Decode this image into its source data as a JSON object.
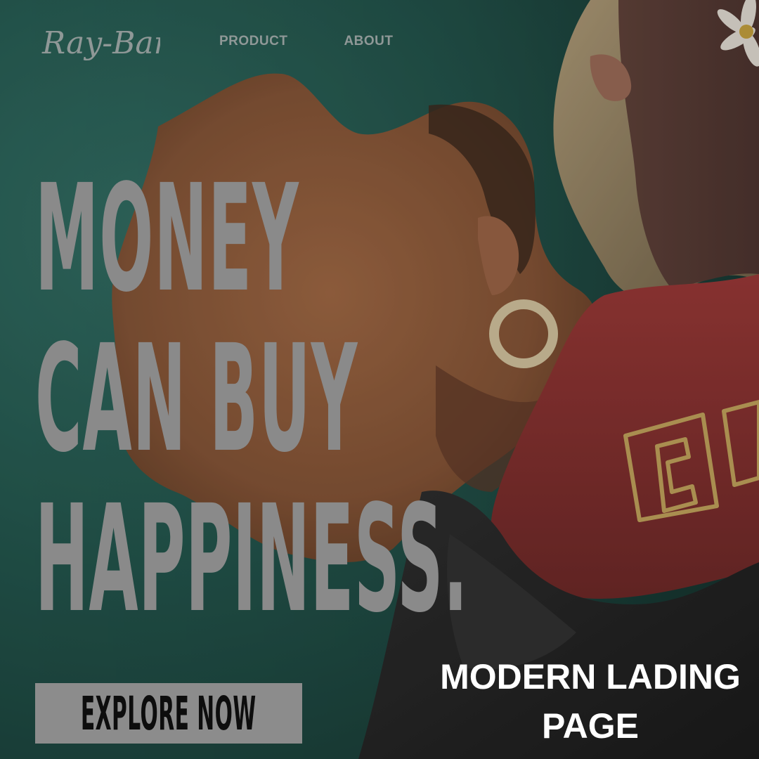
{
  "header": {
    "logo_text": "Ray-Ban",
    "nav": [
      {
        "label": "PRODUCT"
      },
      {
        "label": "ABOUT"
      }
    ]
  },
  "hero": {
    "headline_lines": [
      "MONEY",
      "CAN BUY",
      "HAPPINESS."
    ],
    "cta_label": "EXPLORE NOW"
  },
  "caption": {
    "line1": "MODERN LADING",
    "line2": "PAGE"
  },
  "icons": {
    "logo": "rayban-wordmark-logo",
    "photo": "model-portrait-image"
  },
  "colors": {
    "background_teal": "#1f574d",
    "headline_gray": "#8a8a8a",
    "cta_gray": "#8c8c8c",
    "shirt_red": "#8e2e2c",
    "blob_orange": "#9a5a3a",
    "caption_white": "#ffffff"
  }
}
